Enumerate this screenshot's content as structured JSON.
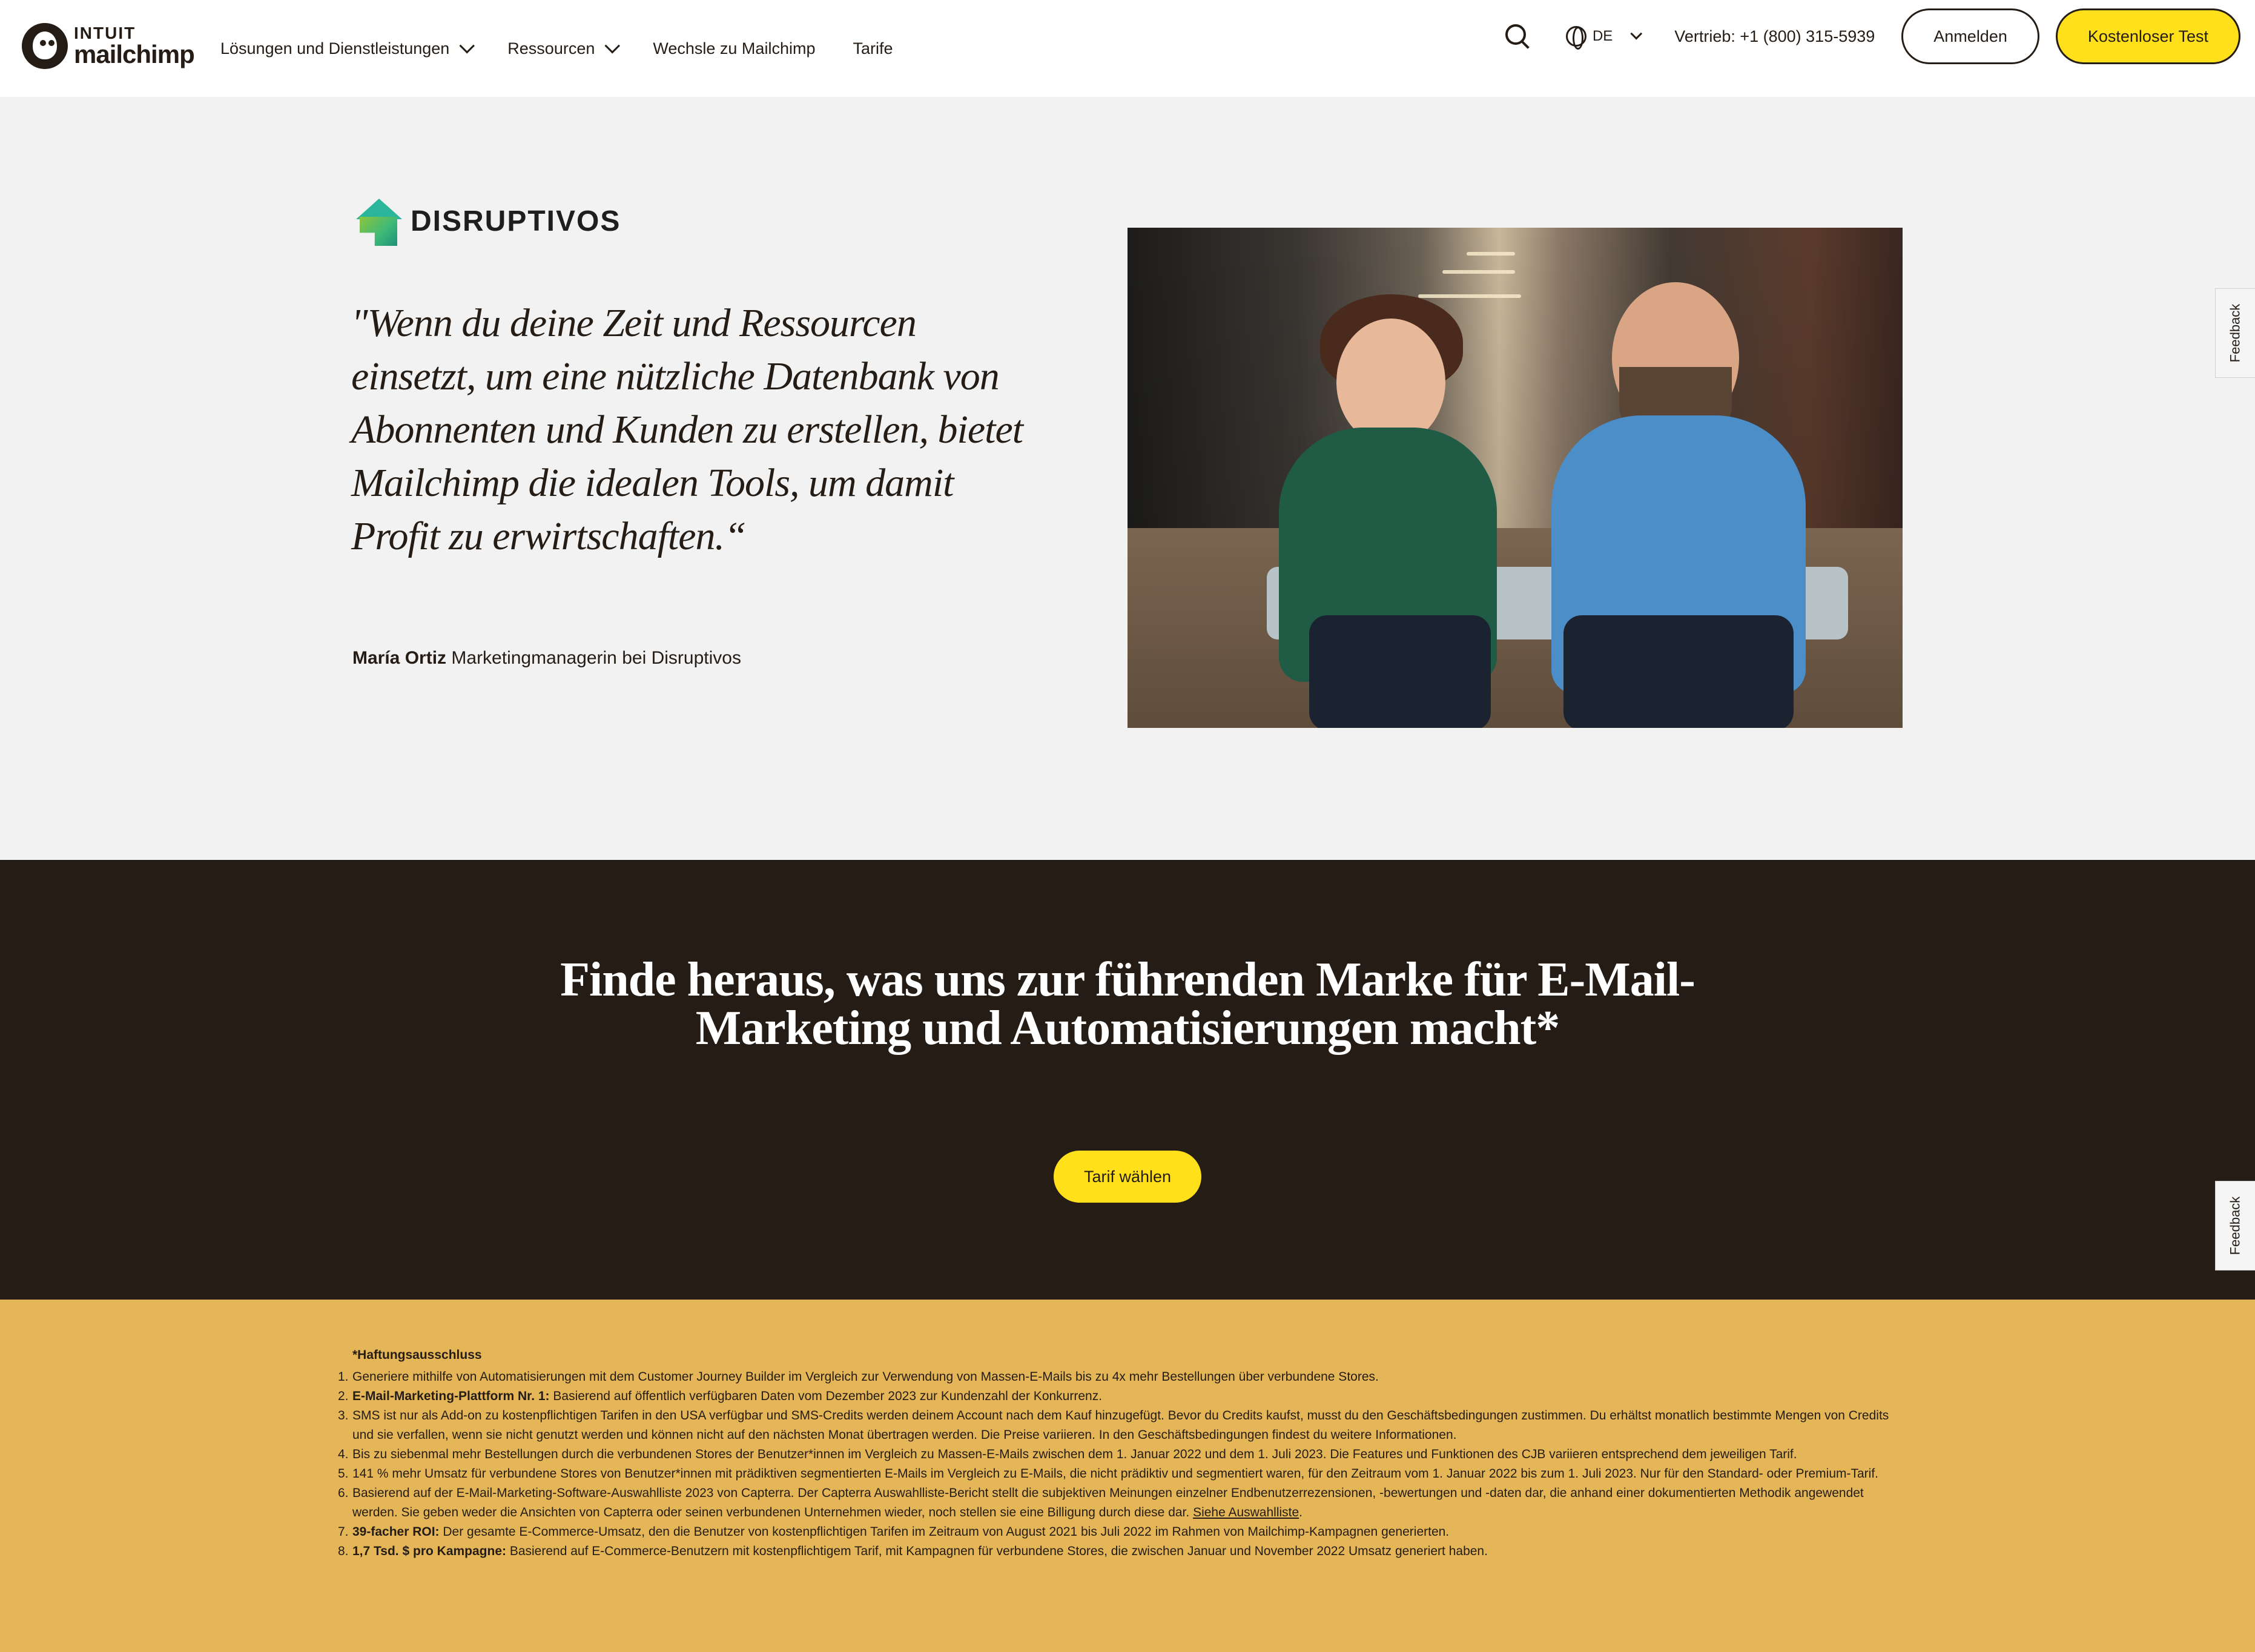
{
  "header": {
    "logo_top": "INTUIT",
    "logo_bottom": "mailchimp",
    "nav": [
      {
        "label": "Lösungen und Dienstleistungen",
        "dropdown": true
      },
      {
        "label": "Ressourcen",
        "dropdown": true
      },
      {
        "label": "Wechsle zu Mailchimp",
        "dropdown": false
      },
      {
        "label": "Tarife",
        "dropdown": false
      }
    ],
    "language": "DE",
    "phone": "Vertrieb: +1 (800) 315-5939",
    "login_label": "Anmelden",
    "trial_label": "Kostenloser Test"
  },
  "testimonial": {
    "brand_name": "DISRUPTIVOS",
    "quote": "\"Wenn du deine Zeit und Ressourcen einsetzt, um eine nützliche Datenbank von Abonnenten und Kunden zu erstellen, bietet Mailchimp die idealen Tools, um damit Profit zu erwirtschaften.“",
    "author_name": "María Ortiz",
    "author_role": "Marketingmanagerin bei Disruptivos"
  },
  "feedback_label": "Feedback",
  "cta": {
    "title": "Finde heraus, was uns zur führenden Marke für E-Mail-Marketing und Automatisierungen macht*",
    "button": "Tarif wählen"
  },
  "disclaimer": {
    "title": "*Haftungsausschluss",
    "items": [
      {
        "n": "1.",
        "bold": "",
        "text": "Generiere mithilfe von Automatisierungen mit dem Customer Journey Builder im Vergleich zur Verwendung von Massen-E-Mails bis zu 4x mehr Bestellungen über verbundene Stores.",
        "link": ""
      },
      {
        "n": "2.",
        "bold": "E-Mail-Marketing-Plattform Nr. 1:",
        "text": " Basierend auf öffentlich verfügbaren Daten vom Dezember 2023 zur Kundenzahl der Konkurrenz.",
        "link": ""
      },
      {
        "n": "3.",
        "bold": "",
        "text": "SMS ist nur als Add-on zu kostenpflichtigen Tarifen in den USA verfügbar und SMS-Credits werden deinem Account nach dem Kauf hinzugefügt. Bevor du Credits kaufst, musst du den Geschäftsbedingungen zustimmen. Du erhältst monatlich bestimmte Mengen von Credits und sie verfallen, wenn sie nicht genutzt werden und können nicht auf den nächsten Monat übertragen werden. Die Preise variieren. In den Geschäftsbedingungen findest du weitere Informationen.",
        "link": ""
      },
      {
        "n": "4.",
        "bold": "",
        "text": "Bis zu siebenmal mehr Bestellungen durch die verbundenen Stores der Benutzer*innen im Vergleich zu Massen-E-Mails zwischen dem 1. Januar 2022 und dem 1. Juli 2023. Die Features und Funktionen des CJB variieren entsprechend dem jeweiligen Tarif.",
        "link": ""
      },
      {
        "n": "5.",
        "bold": "",
        "text": "141 % mehr Umsatz für verbundene Stores von Benutzer*innen mit prädiktiven segmentierten E-Mails im Vergleich zu E-Mails, die nicht prädiktiv und segmentiert waren, für den Zeitraum vom 1. Januar 2022 bis zum 1. Juli 2023. Nur für den Standard- oder Premium-Tarif.",
        "link": ""
      },
      {
        "n": "6.",
        "bold": "",
        "text": "Basierend auf der E-Mail-Marketing-Software-Auswahlliste 2023 von Capterra. Der Capterra Auswahlliste-Bericht stellt die subjektiven Meinungen einzelner Endbenutzerrezensionen, -bewertungen und -daten dar, die anhand einer dokumentierten Methodik angewendet werden. Sie geben weder die Ansichten von Capterra oder seinen verbundenen Unternehmen wieder, noch stellen sie eine Billigung durch diese dar. ",
        "link": "Siehe Auswahlliste"
      },
      {
        "n": "7.",
        "bold": "39-facher ROI:",
        "text": " Der gesamte E-Commerce-Umsatz, den die Benutzer von kostenpflichtigen Tarifen im Zeitraum von August 2021 bis Juli 2022 im Rahmen von Mailchimp-Kampagnen generierten.",
        "link": ""
      },
      {
        "n": "8.",
        "bold": "1,7 Tsd. $ pro Kampagne:",
        "text": " Basierend auf E-Commerce-Benutzern mit kostenpflichtigem Tarif, mit Kampagnen für verbundene Stores, die zwischen Januar und November 2022 Umsatz generiert haben.",
        "link": ""
      }
    ],
    "item_suffix": "."
  },
  "colors": {
    "brand_yellow": "#ffe01b",
    "dark": "#241c15",
    "testimonial_bg": "#f2f2f2",
    "disclaimer_bg": "#e5b658"
  },
  "icons": [
    "chevron-down-icon",
    "search-icon",
    "globe-icon",
    "mailchimp-logo-icon",
    "disruptivos-logo-icon"
  ]
}
